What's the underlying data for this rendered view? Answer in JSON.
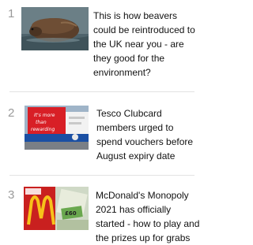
{
  "articles": [
    {
      "rank": "1",
      "headline": "This is how beavers could be reintroduced to the UK near you - are they good for the environment?",
      "thumbnail": "beaver-photo"
    },
    {
      "rank": "2",
      "headline": "Tesco Clubcard members urged to spend vouchers before August expiry date",
      "thumbnail": "tesco-clubcard-sign-photo",
      "thumbnail_text": "It's more than rewarding"
    },
    {
      "rank": "3",
      "headline": "McDonald's Monopoly 2021 has officially started - how to play and the prizes up for grabs",
      "thumbnail": "mcdonalds-monopoly-photo"
    }
  ]
}
